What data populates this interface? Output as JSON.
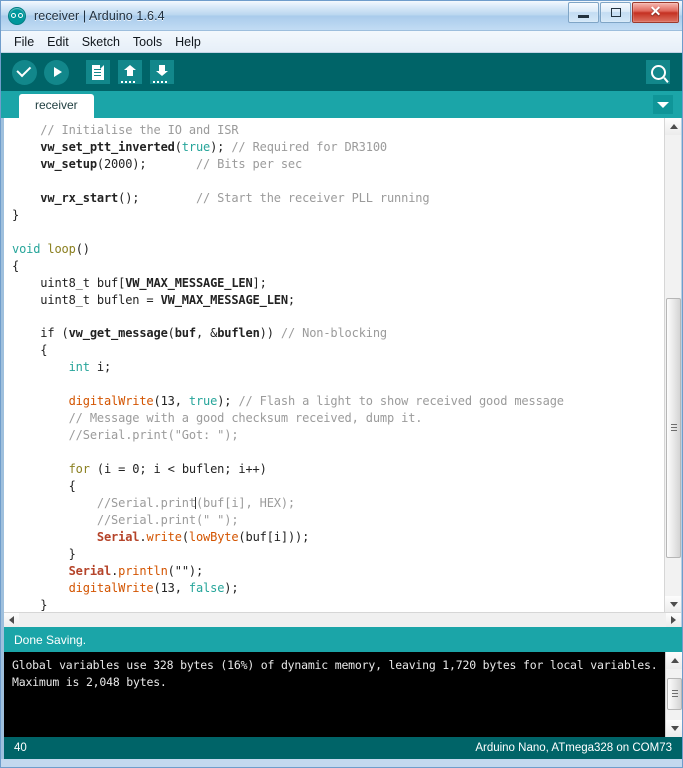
{
  "window": {
    "title": "receiver | Arduino 1.6.4",
    "logo_icon": "arduino-logo",
    "buttons": {
      "minimize": "minimize-icon",
      "maximize": "maximize-icon",
      "close": "✕"
    }
  },
  "menubar": {
    "items": [
      {
        "label": "File"
      },
      {
        "label": "Edit"
      },
      {
        "label": "Sketch"
      },
      {
        "label": "Tools"
      },
      {
        "label": "Help"
      }
    ]
  },
  "toolbar": {
    "buttons": [
      {
        "name": "verify-button",
        "icon": "checkmark-icon",
        "label": "Verify"
      },
      {
        "name": "upload-button",
        "icon": "arrow-right-icon",
        "label": "Upload"
      },
      {
        "name": "new-button",
        "icon": "new-document-icon",
        "label": "New"
      },
      {
        "name": "open-button",
        "icon": "upload-arrow-icon",
        "label": "Open"
      },
      {
        "name": "save-button",
        "icon": "download-arrow-icon",
        "label": "Save"
      }
    ],
    "serial_monitor": {
      "icon": "magnifier-icon",
      "label": "Serial Monitor"
    }
  },
  "tabs": {
    "items": [
      {
        "label": "receiver",
        "active": true
      }
    ],
    "dropdown_icon": "chevron-down-icon"
  },
  "editor": {
    "code_lines": [
      "    // Initialise the IO and ISR",
      "    vw_set_ptt_inverted(true); // Required for DR3100",
      "    vw_setup(2000);       // Bits per sec",
      "",
      "    vw_rx_start();        // Start the receiver PLL running",
      "}",
      "",
      "void loop()",
      "{",
      "    uint8_t buf[VW_MAX_MESSAGE_LEN];",
      "    uint8_t buflen = VW_MAX_MESSAGE_LEN;",
      "",
      "    if (vw_get_message(buf, &buflen)) // Non-blocking",
      "    {",
      "        int i;",
      "",
      "        digitalWrite(13, true); // Flash a light to show received good message",
      "        // Message with a good checksum received, dump it.",
      "        //Serial.print(\"Got: \");",
      "",
      "        for (i = 0; i < buflen; i++)",
      "        {",
      "            //Serial.print(buf[i], HEX);",
      "            //Serial.print(\" \");",
      "            Serial.write(lowByte(buf[i]));",
      "        }",
      "        Serial.println(\"\");",
      "        digitalWrite(13, false);",
      "    }"
    ]
  },
  "status": {
    "message": "Done Saving."
  },
  "console": {
    "output": "Global variables use 328 bytes (16%) of dynamic memory, leaving 1,720 bytes for local variables. Maximum is 2,048 bytes."
  },
  "statusbar": {
    "line_number": "40",
    "board_info": "Arduino Nano, ATmega328 on COM73"
  },
  "colors": {
    "toolbar_teal": "#006468",
    "tabbar_teal": "#1ba5a8",
    "console_bg": "#000000",
    "keyword": "#26a59a",
    "function": "#d35400",
    "comment": "#9b9b9b",
    "serial_class": "#b5442a"
  }
}
